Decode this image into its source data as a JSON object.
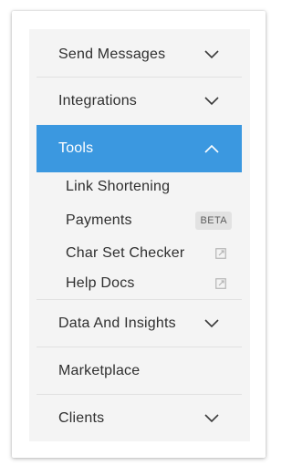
{
  "menu": {
    "send_messages": "Send Messages",
    "integrations": "Integrations",
    "tools": "Tools",
    "tools_sub": {
      "link_shortening": "Link Shortening",
      "payments": "Payments",
      "payments_badge": "BETA",
      "char_set_checker": "Char Set Checker",
      "help_docs": "Help Docs"
    },
    "data_and_insights": "Data And Insights",
    "marketplace": "Marketplace",
    "clients": "Clients"
  },
  "colors": {
    "active_background": "#3b98e0",
    "panel_background": "#f4f4f4",
    "badge_background": "#e2e2e2"
  },
  "icons": {
    "expand": "chevron-down-icon",
    "collapse": "chevron-up-icon",
    "external_link": "external-link-icon"
  }
}
